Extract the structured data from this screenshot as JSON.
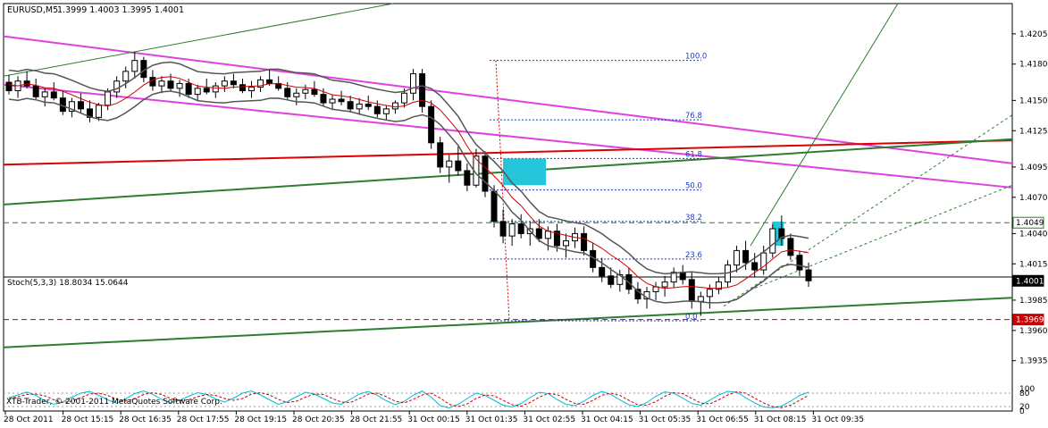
{
  "chart_data": [
    {
      "type": "candlestick",
      "panel": "main",
      "title": "EURUSD,M5",
      "ohlc_label": "1.3999 1.4003 1.3995 1.4001",
      "ylim": [
        1.392,
        1.423
      ],
      "y_ticks": [
        "1.4205",
        "1.4180",
        "1.4150",
        "1.4125",
        "1.4095",
        "1.4070",
        "1.4040",
        "1.4015",
        "1.3985",
        "1.3960",
        "1.3935"
      ],
      "x_ticks": [
        "28 Oct 2011",
        "28 Oct 15:15",
        "28 Oct 16:35",
        "28 Oct 17:55",
        "28 Oct 19:15",
        "28 Oct 20:35",
        "28 Oct 21:55",
        "31 Oct 00:15",
        "31 Oct 01:35",
        "31 Oct 02:55",
        "31 Oct 04:15",
        "31 Oct 05:35",
        "31 Oct 06:55",
        "31 Oct 08:15",
        "31 Oct 09:35"
      ],
      "price_markers": [
        {
          "label": "1.4049",
          "value": 1.4049,
          "bg": "#ffffff",
          "fg": "#000000",
          "border": "#2e7d32"
        },
        {
          "label": "1.4001",
          "value": 1.4001,
          "bg": "#000000",
          "fg": "#ffffff",
          "border": "#000000"
        },
        {
          "label": "1.3969",
          "value": 1.3969,
          "bg": "#cc0000",
          "fg": "#ffffff",
          "border": "#cc0000"
        }
      ],
      "fibonacci_levels": [
        {
          "label": "100.0",
          "value": 1.4183
        },
        {
          "label": "76.8",
          "value": 1.4134
        },
        {
          "label": "61.8",
          "value": 1.4102
        },
        {
          "label": "50.0",
          "value": 1.4076
        },
        {
          "label": "38.2",
          "value": 1.405
        },
        {
          "label": "23.6",
          "value": 1.4019
        },
        {
          "label": "0.0",
          "value": 1.3968
        }
      ],
      "candles": [
        [
          1.4165,
          1.4171,
          1.4155,
          1.4158
        ],
        [
          1.4158,
          1.417,
          1.4152,
          1.4166
        ],
        [
          1.4166,
          1.4174,
          1.416,
          1.4162
        ],
        [
          1.4162,
          1.4168,
          1.415,
          1.4153
        ],
        [
          1.4153,
          1.416,
          1.4145,
          1.4157
        ],
        [
          1.4157,
          1.4165,
          1.415,
          1.4152
        ],
        [
          1.4152,
          1.4158,
          1.4138,
          1.4141
        ],
        [
          1.4141,
          1.4152,
          1.4136,
          1.4149
        ],
        [
          1.4149,
          1.4156,
          1.414,
          1.4143
        ],
        [
          1.4143,
          1.415,
          1.4132,
          1.4136
        ],
        [
          1.4136,
          1.4148,
          1.4133,
          1.4146
        ],
        [
          1.4146,
          1.416,
          1.4142,
          1.4157
        ],
        [
          1.4157,
          1.417,
          1.4152,
          1.4166
        ],
        [
          1.4166,
          1.4178,
          1.416,
          1.4174
        ],
        [
          1.4174,
          1.419,
          1.4168,
          1.4183
        ],
        [
          1.4183,
          1.4186,
          1.4165,
          1.4169
        ],
        [
          1.4169,
          1.4175,
          1.4158,
          1.4162
        ],
        [
          1.4162,
          1.417,
          1.4156,
          1.4166
        ],
        [
          1.4166,
          1.4172,
          1.4158,
          1.416
        ],
        [
          1.416,
          1.4167,
          1.4153,
          1.4164
        ],
        [
          1.4164,
          1.4168,
          1.4152,
          1.4155
        ],
        [
          1.4155,
          1.4163,
          1.415,
          1.416
        ],
        [
          1.416,
          1.4168,
          1.4155,
          1.4157
        ],
        [
          1.4157,
          1.4165,
          1.4152,
          1.4162
        ],
        [
          1.4162,
          1.417,
          1.4157,
          1.4166
        ],
        [
          1.4166,
          1.4172,
          1.416,
          1.4163
        ],
        [
          1.4163,
          1.4168,
          1.4156,
          1.4158
        ],
        [
          1.4158,
          1.4166,
          1.4152,
          1.4161
        ],
        [
          1.4161,
          1.417,
          1.4157,
          1.4167
        ],
        [
          1.4167,
          1.4175,
          1.4162,
          1.4164
        ],
        [
          1.4164,
          1.417,
          1.4158,
          1.416
        ],
        [
          1.416,
          1.4165,
          1.415,
          1.4153
        ],
        [
          1.4153,
          1.416,
          1.4146,
          1.4156
        ],
        [
          1.4156,
          1.4163,
          1.4151,
          1.4159
        ],
        [
          1.4159,
          1.4166,
          1.4153,
          1.4155
        ],
        [
          1.4155,
          1.416,
          1.4145,
          1.4148
        ],
        [
          1.4148,
          1.4155,
          1.4142,
          1.4151
        ],
        [
          1.4151,
          1.4158,
          1.4146,
          1.4149
        ],
        [
          1.4149,
          1.4154,
          1.414,
          1.4143
        ],
        [
          1.4143,
          1.4152,
          1.4138,
          1.4147
        ],
        [
          1.4147,
          1.4154,
          1.4142,
          1.4145
        ],
        [
          1.4145,
          1.415,
          1.4136,
          1.4139
        ],
        [
          1.4139,
          1.4146,
          1.4134,
          1.4143
        ],
        [
          1.4143,
          1.415,
          1.4139,
          1.4148
        ],
        [
          1.4148,
          1.416,
          1.4144,
          1.4156
        ],
        [
          1.4156,
          1.4176,
          1.415,
          1.4172
        ],
        [
          1.4172,
          1.4176,
          1.414,
          1.4145
        ],
        [
          1.4145,
          1.415,
          1.411,
          1.4115
        ],
        [
          1.4115,
          1.412,
          1.409,
          1.4095
        ],
        [
          1.4095,
          1.4105,
          1.4082,
          1.41
        ],
        [
          1.41,
          1.4112,
          1.4088,
          1.4092
        ],
        [
          1.4092,
          1.4098,
          1.4075,
          1.408
        ],
        [
          1.408,
          1.411,
          1.4078,
          1.4104
        ],
        [
          1.4104,
          1.4108,
          1.407,
          1.4075
        ],
        [
          1.4075,
          1.408,
          1.4045,
          1.405
        ],
        [
          1.405,
          1.406,
          1.4032,
          1.4038
        ],
        [
          1.4038,
          1.4052,
          1.403,
          1.4048
        ],
        [
          1.4048,
          1.4056,
          1.4036,
          1.404
        ],
        [
          1.404,
          1.405,
          1.403,
          1.4044
        ],
        [
          1.4044,
          1.4052,
          1.4033,
          1.4036
        ],
        [
          1.4036,
          1.4046,
          1.4026,
          1.4042
        ],
        [
          1.4042,
          1.4048,
          1.4025,
          1.403
        ],
        [
          1.403,
          1.404,
          1.402,
          1.4034
        ],
        [
          1.4034,
          1.4045,
          1.4028,
          1.404
        ],
        [
          1.404,
          1.4046,
          1.4022,
          1.4026
        ],
        [
          1.4026,
          1.4032,
          1.4008,
          1.4012
        ],
        [
          1.4012,
          1.402,
          1.4,
          1.4005
        ],
        [
          1.4005,
          1.4012,
          1.3995,
          1.3998
        ],
        [
          1.3998,
          1.401,
          1.3992,
          1.4006
        ],
        [
          1.4006,
          1.4012,
          1.399,
          1.3994
        ],
        [
          1.3994,
          1.4,
          1.3982,
          1.3986
        ],
        [
          1.3986,
          1.3996,
          1.3978,
          1.3992
        ],
        [
          1.3992,
          1.4,
          1.3985,
          1.3996
        ],
        [
          1.3996,
          1.4005,
          1.3988,
          1.4
        ],
        [
          1.4,
          1.4012,
          1.3995,
          1.4008
        ],
        [
          1.4008,
          1.4014,
          1.3998,
          1.4002
        ],
        [
          1.4002,
          1.4008,
          1.3978,
          1.3984
        ],
        [
          1.3984,
          1.3992,
          1.3972,
          1.3988
        ],
        [
          1.3988,
          1.3998,
          1.3978,
          1.3994
        ],
        [
          1.3994,
          1.4004,
          1.399,
          1.4
        ],
        [
          1.4,
          1.4018,
          1.3996,
          1.4014
        ],
        [
          1.4014,
          1.403,
          1.4008,
          1.4026
        ],
        [
          1.4026,
          1.4034,
          1.401,
          1.4016
        ],
        [
          1.4016,
          1.4024,
          1.4004,
          1.401
        ],
        [
          1.401,
          1.403,
          1.4006,
          1.4024
        ],
        [
          1.4024,
          1.4048,
          1.402,
          1.4044
        ],
        [
          1.4044,
          1.4055,
          1.403,
          1.4036
        ],
        [
          1.4036,
          1.404,
          1.4018,
          1.4022
        ],
        [
          1.4022,
          1.4026,
          1.4005,
          1.401
        ],
        [
          1.401,
          1.4016,
          1.3996,
          1.4001
        ]
      ]
    },
    {
      "type": "line",
      "panel": "stochastic",
      "title": "Stoch(5,3,3) 18.8034 15.0644",
      "ylim": [
        0,
        100
      ],
      "y_ticks": [
        "100",
        "80",
        "20",
        "0"
      ],
      "series": [
        {
          "values": [
            60,
            72,
            85,
            70,
            45,
            30,
            40,
            62,
            80,
            88,
            70,
            50,
            35,
            55,
            78,
            90,
            75,
            52,
            38,
            48,
            66,
            82,
            74,
            55,
            40,
            58,
            80,
            90,
            72,
            50,
            30,
            42,
            64,
            84,
            76,
            56,
            36,
            30,
            52,
            76,
            88,
            70,
            46,
            28,
            44,
            70,
            90,
            62,
            24,
            14,
            30,
            56,
            80,
            70,
            48,
            26,
            18,
            34,
            60,
            84,
            78,
            52,
            30,
            24,
            44,
            70,
            88,
            74,
            50,
            28,
            20,
            38,
            66,
            86,
            80,
            58,
            34,
            26,
            48,
            72,
            88,
            84,
            60,
            36,
            18,
            15,
            22,
            44,
            70,
            84
          ],
          "color": "#00bcd4"
        },
        {
          "values": [
            55,
            64,
            74,
            76,
            68,
            50,
            38,
            44,
            60,
            76,
            80,
            70,
            52,
            44,
            55,
            74,
            82,
            74,
            56,
            46,
            50,
            64,
            74,
            70,
            56,
            48,
            56,
            76,
            82,
            72,
            52,
            38,
            44,
            62,
            76,
            74,
            56,
            40,
            38,
            56,
            76,
            80,
            64,
            44,
            36,
            52,
            72,
            80,
            58,
            30,
            20,
            32,
            56,
            72,
            68,
            48,
            28,
            22,
            38,
            62,
            78,
            74,
            52,
            34,
            30,
            48,
            70,
            80,
            70,
            48,
            28,
            26,
            42,
            66,
            82,
            78,
            56,
            36,
            32,
            50,
            72,
            86,
            80,
            58,
            36,
            20,
            15,
            26,
            48,
            70
          ],
          "color": "#cc0000"
        }
      ]
    }
  ],
  "footer": {
    "copyright": "XTB-Trader, © 2001-2011 MetaQuotes Software Corp."
  }
}
